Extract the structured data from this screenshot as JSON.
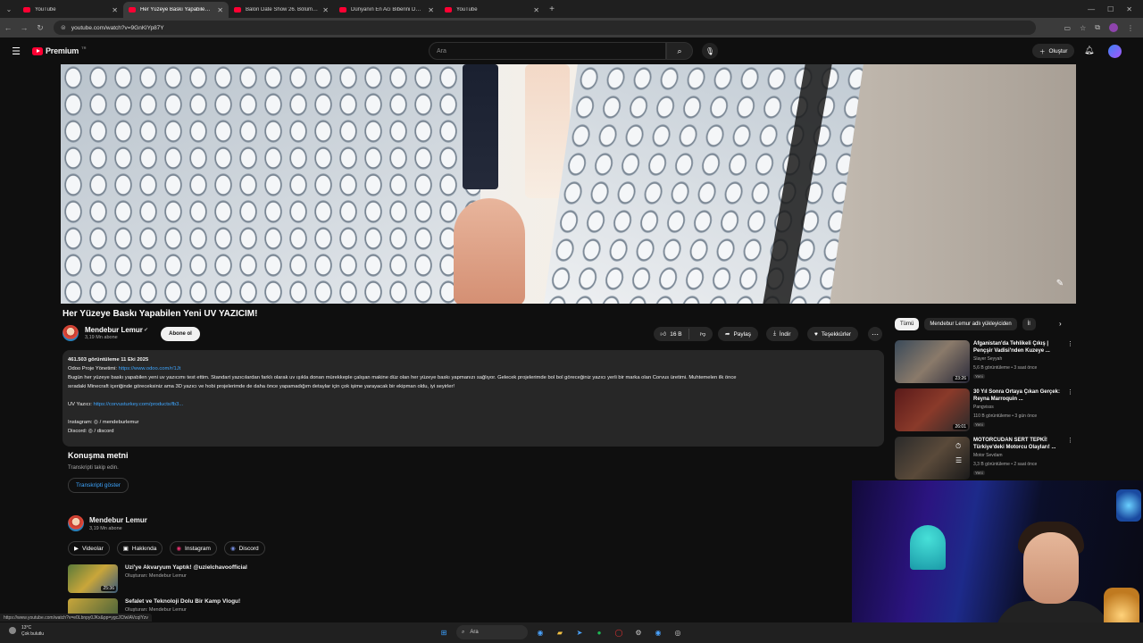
{
  "browser": {
    "tabs": [
      {
        "title": "YouTube",
        "active": false
      },
      {
        "title": "Her Yüzeye Baskı Yapabilen Ye",
        "active": true
      },
      {
        "title": "Balon Date Show 26. Bölüm - Y",
        "active": false
      },
      {
        "title": "Dünyanın En Acı Biberini Deneı",
        "active": false
      },
      {
        "title": "YouTube",
        "active": false
      }
    ],
    "url": "youtube.com/watch?v=9GnKlYp87Y",
    "status_url": "https://www.youtube.com/watch?v=e0Lbnpy0JKx&pp=ygcJCfwIAVcqIYzv"
  },
  "header": {
    "logo_text": "Premium",
    "logo_region": "TR",
    "search_placeholder": "Ara",
    "create_label": "Oluştur"
  },
  "video": {
    "title": "Her Yüzeye Baskı Yapabilen Yeni UV YAZICIM!",
    "channel": "Mendebur Lemur",
    "subscribers": "3,19 Mn abone",
    "subscribe_label": "Abone ol",
    "likes": "16 B",
    "share_label": "Paylaş",
    "download_label": "İndir",
    "thanks_label": "Teşekkürler"
  },
  "description": {
    "meta": "461.503 görüntüleme  11 Eki 2025",
    "line_odoo_label": "Odoo Proje Yönetimi: ",
    "line_odoo_link": "https://www.odoo.com/r/1Jt",
    "paragraph": "Bugün her yüzeye baskı yapabilen yeni uv yazıcımı test ettim. Standart yazıcılardan farklı olarak uv ışıkla donan mürekkeple çalışan makine düz olan her yüzeye baskı yapmanızı sağlıyor. Gelecek projelerimde bol bol göreceğiniz yazıcı yerli bir marka olan Corvus üretimi. Muhtemelen ilk önce",
    "paragraph2": "sıradaki Minecraft içeriğinde göreceksiniz ama 3D yazıcı ve hobi projelerimde de daha önce yapamadığım detaylar için çok işime yarayacak bir ekipman oldu, iyi seyirler!",
    "uv_label": "UV Yazıcı: ",
    "uv_link": "https://corvusturkey.com/products/fb3...",
    "instagram_label": "Instagram: ",
    "instagram_value": "/ mendeburlemur",
    "discord_label": "Discord: ",
    "discord_value": "/ discord"
  },
  "transcript": {
    "heading": "Konuşma metni",
    "subtitle": "Transkripti takip edin.",
    "button": "Transkripti göster"
  },
  "channel_section": {
    "name": "Mendebur Lemur",
    "subscribers": "3,19 Mn abone",
    "tabs": [
      "Videolar",
      "Hakkında",
      "Instagram",
      "Discord"
    ],
    "videos": [
      {
        "title": "Uzi'ye Akvaryum Yaptık! @uzielchavoofficial",
        "channel": "Oluşturan: Mendebur Lemur",
        "duration": "25:36"
      },
      {
        "title": "Sefalet ve Teknoloji Dolu Bir Kamp Vlogu!",
        "channel": "Oluşturan: Mendebur Lemur",
        "duration": ""
      }
    ]
  },
  "sidebar": {
    "chips": [
      "Tümü",
      "Mendebur Lemur adlı yükleyiciden",
      "İl"
    ],
    "recommendations": [
      {
        "title": "Afganistan'da Tehlikeli Çıkış | Pençşir Vadisi'nden Kuzeye ...",
        "channel": "Slayer Seyyah",
        "views": "5,6 B görüntüleme • 3 saat önce",
        "badge": "Yeni",
        "duration": "23:26"
      },
      {
        "title": "30 Yıl Sonra Ortaya Çıkan Gerçek: Reyna Marroquin ...",
        "channel": "Pangvisss",
        "views": "110 B görüntüleme • 3 gün önce",
        "badge": "Yeni",
        "duration": "26:01"
      },
      {
        "title": "MOTORCUDAN SERT TEPKİ! Türkiye'deki Motorcu Olayları! ...",
        "channel": "Motor Sevdam",
        "views": "3,3 B görüntüleme • 2 saat önce",
        "badge": "Yeni",
        "duration": ""
      }
    ]
  },
  "taskbar": {
    "temp": "13°C",
    "weather": "Çok bulutlu",
    "search": "Ara"
  }
}
